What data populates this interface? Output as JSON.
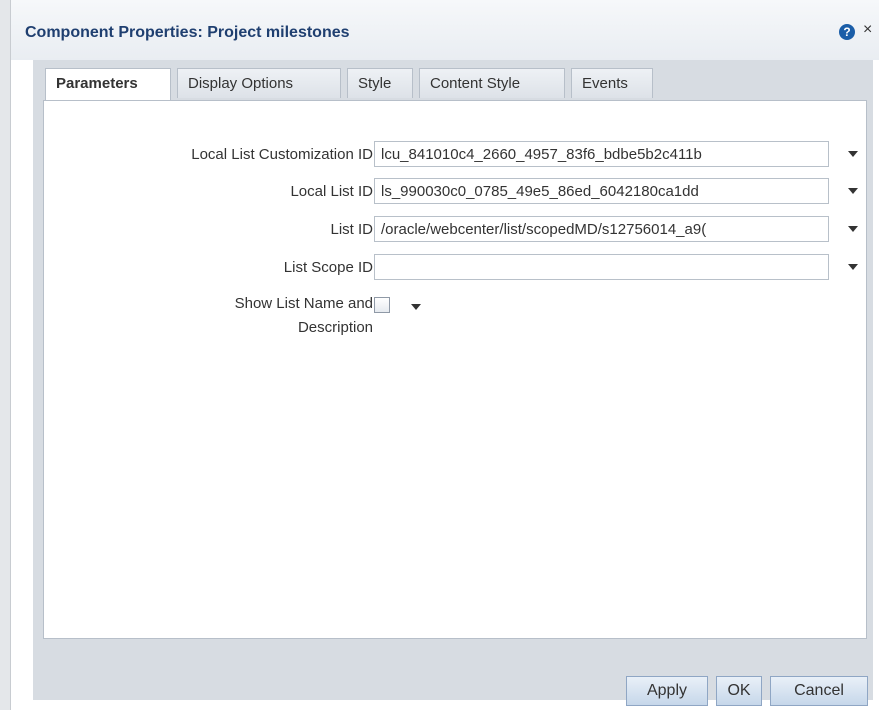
{
  "dialog": {
    "title": "Component Properties: Project milestones",
    "help_icon": "?",
    "close_icon": "×"
  },
  "tabs": [
    "Parameters",
    "Display Options",
    "Style",
    "Content Style",
    "Events"
  ],
  "active_tab": "Parameters",
  "parameters": [
    {
      "label": "Local List Customization ID",
      "value": "lcu_841010c4_2660_4957_83f6_bdbe5b2c411b"
    },
    {
      "label": "Local List ID",
      "value": "ls_990030c0_0785_49e5_86ed_6042180ca1dd"
    },
    {
      "label": "List ID",
      "value": "/oracle/webcenter/list/scopedMD/s12756014_a9("
    },
    {
      "label": "List Scope ID",
      "value": ""
    },
    {
      "label_line1": "Show List Name and",
      "label_line2": "Description",
      "checked": false
    }
  ],
  "buttons": {
    "apply": "Apply",
    "ok": "OK",
    "cancel": "Cancel"
  }
}
